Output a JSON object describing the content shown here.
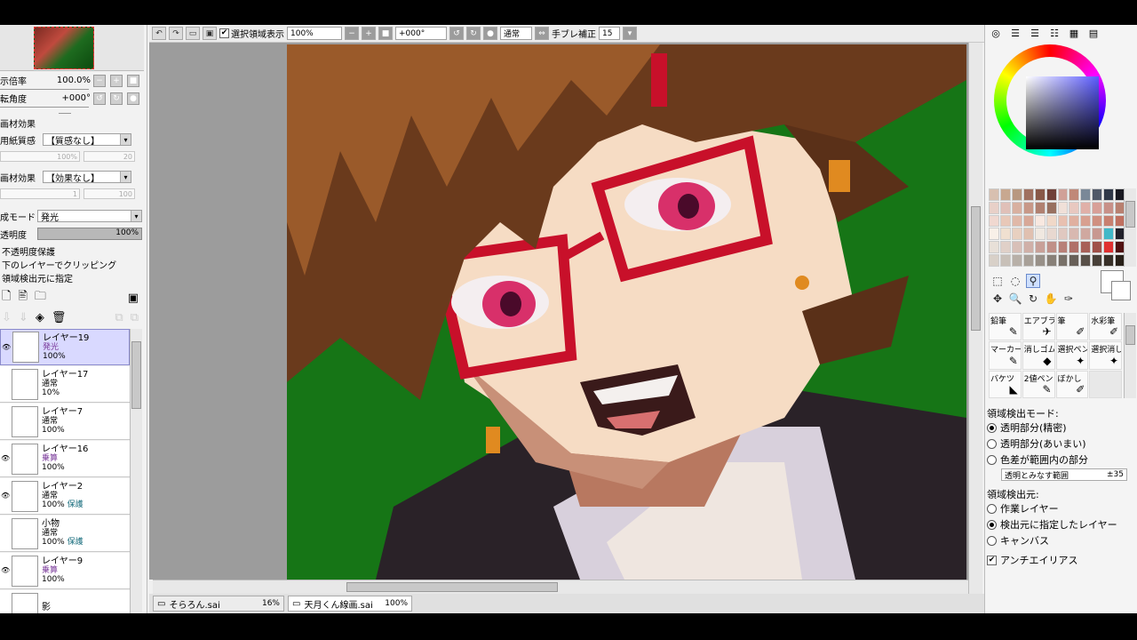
{
  "toolbar": {
    "selection_checkbox": "✔",
    "selection_label": "選択領域表示",
    "zoom": "100%",
    "rotation": "+000°",
    "blend_mode": "通常",
    "stabilizer_label": "手ブレ補正",
    "stabilizer_value": "15"
  },
  "navigator": {
    "zoom_label": "示倍率",
    "zoom_value": "100.0%",
    "rotation_label": "転角度",
    "rotation_value": "+000°"
  },
  "texture": {
    "section": "画材効果",
    "paper_label": "用紙質感",
    "paper_value": "【質感なし】",
    "paper_rate": "100%",
    "paper_strength": "20",
    "effect_label": "画材効果",
    "effect_value": "【効果なし】",
    "effect_width": "1",
    "effect_strength": "100"
  },
  "layer_props": {
    "blend_label": "成モード",
    "blend_value": "発光",
    "opacity_label": "透明度",
    "opacity_value": "100%",
    "opt1": "不透明度保護",
    "opt2": "下のレイヤーでクリッピング",
    "opt3": "領域検出元に指定"
  },
  "layers": [
    {
      "name": "レイヤー19",
      "mode": "発光",
      "opacity": "100%",
      "extra": ""
    },
    {
      "name": "レイヤー17",
      "mode": "通常",
      "opacity": "10%",
      "extra": ""
    },
    {
      "name": "レイヤー7",
      "mode": "通常",
      "opacity": "100%",
      "extra": ""
    },
    {
      "name": "レイヤー16",
      "mode": "乗算",
      "opacity": "100%",
      "extra": ""
    },
    {
      "name": "レイヤー2",
      "mode": "通常",
      "opacity": "100%",
      "extra": "保護"
    },
    {
      "name": "小物",
      "mode": "通常",
      "opacity": "100%",
      "extra": "保護"
    },
    {
      "name": "レイヤー9",
      "mode": "乗算",
      "opacity": "100%",
      "extra": ""
    },
    {
      "name": "影",
      "mode": "",
      "opacity": "",
      "extra": ""
    }
  ],
  "tabs": [
    {
      "name": "そらろん.sai",
      "zoom": "16%"
    },
    {
      "name": "天月くん線画.sai",
      "zoom": "100%"
    }
  ],
  "brushes": [
    {
      "name": "鉛筆",
      "icon": "✎"
    },
    {
      "name": "エアブラシ",
      "icon": "✈"
    },
    {
      "name": "筆",
      "icon": "✐"
    },
    {
      "name": "水彩筆",
      "icon": "✐"
    },
    {
      "name": "マーカー",
      "icon": "✎"
    },
    {
      "name": "消しゴム",
      "icon": "◆"
    },
    {
      "name": "選択ペン",
      "icon": "✦"
    },
    {
      "name": "選択消し",
      "icon": "✦"
    },
    {
      "name": "バケツ",
      "icon": "◣"
    },
    {
      "name": "2値ペン",
      "icon": "✎"
    },
    {
      "name": "ぼかし",
      "icon": "✐"
    },
    {
      "name": "",
      "icon": ""
    }
  ],
  "detect": {
    "mode_label": "領域検出モード:",
    "mode_options": [
      "透明部分(精密)",
      "透明部分(あいまい)",
      "色差が範囲内の部分"
    ],
    "range_label": "透明とみなす範囲",
    "range_value": "±35",
    "source_label": "領域検出元:",
    "source_options": [
      "作業レイヤー",
      "検出元に指定したレイヤー",
      "キャンバス"
    ],
    "antialias_label": "アンチエイリアス",
    "antialias_check": "✔"
  },
  "swatch_colors": [
    "#d8c0b0",
    "#c8a890",
    "#b89880",
    "#a07060",
    "#885848",
    "#704038",
    "#d0a098",
    "#c08878",
    "#7a8898",
    "#505868",
    "#303848",
    "#181820",
    "#e8d0c8",
    "#e0c0b8",
    "#d8b0a0",
    "#c89888",
    "#b08070",
    "#987060",
    "#f0e0d8",
    "#e8c8c0",
    "#e0b0a8",
    "#d8a098",
    "#c89088",
    "#b88070",
    "#f0d8d0",
    "#e8c8b8",
    "#e0b8a8",
    "#d8a898",
    "#f8e8e0",
    "#f0d8c8",
    "#e8c0b0",
    "#e0b0a0",
    "#d8a090",
    "#d09080",
    "#c88070",
    "#c07060",
    "#f8f0e8",
    "#f0e0d0",
    "#e8d0c0",
    "#e0c0b0",
    "#f0e8e0",
    "#e8d8d0",
    "#e0c8c0",
    "#d8b8b0",
    "#d0a8a0",
    "#c89890",
    "#40b8c8",
    "#20202a",
    "#e8e0d8",
    "#e0d0c8",
    "#d8c0b8",
    "#d0b0a8",
    "#c8a098",
    "#c09088",
    "#b88078",
    "#b07068",
    "#a86058",
    "#a05048",
    "#e03030",
    "#501010",
    "#d8d0c8",
    "#c8c0b8",
    "#b8b0a8",
    "#a8a098",
    "#989088",
    "#888078",
    "#787068",
    "#686058",
    "#585048",
    "#484038",
    "#383028",
    "#282018"
  ]
}
